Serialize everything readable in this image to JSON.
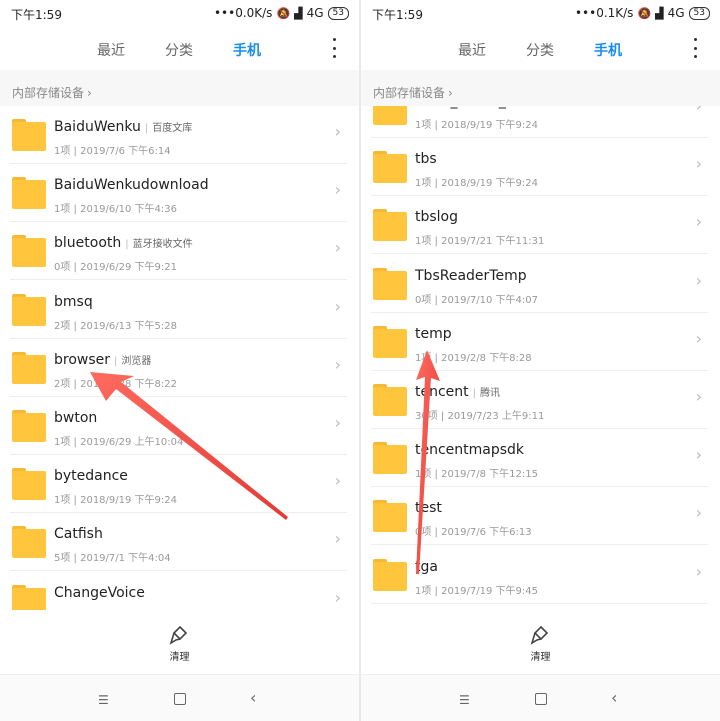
{
  "colors": {
    "accent": "#1a8cf0",
    "folder": "#ffc53d",
    "arrow": "#e84a4a"
  },
  "left": {
    "status": {
      "time": "下午1:59",
      "network": "•••0.0K/s",
      "signal": "4G",
      "battery": "53"
    },
    "tabs": [
      "最近",
      "分类",
      "手机"
    ],
    "active_tab": "手机",
    "breadcrumb": "内部存储设备",
    "items": [
      {
        "name": "BaiduWenku",
        "tag": "百度文库",
        "meta": "1项 | 2019/7/6 下午6:14"
      },
      {
        "name": "BaiduWenkudownload",
        "tag": "",
        "meta": "1项 | 2019/6/10 下午4:36"
      },
      {
        "name": "bluetooth",
        "tag": "蓝牙接收文件",
        "meta": "0项 | 2019/6/29 下午9:21"
      },
      {
        "name": "bmsq",
        "tag": "",
        "meta": "2项 | 2019/6/13 下午5:28"
      },
      {
        "name": "browser",
        "tag": "浏览器",
        "meta": "2项 | 2019/7/28 下午8:22"
      },
      {
        "name": "bwton",
        "tag": "",
        "meta": "1项 | 2019/6/29 上午10:04"
      },
      {
        "name": "bytedance",
        "tag": "",
        "meta": "1项 | 2018/9/19 下午9:24"
      },
      {
        "name": "Catfish",
        "tag": "",
        "meta": "5项 | 2019/7/1 下午4:04"
      },
      {
        "name": "ChangeVoice",
        "tag": "",
        "meta": ""
      }
    ],
    "cleaner_label": "清理"
  },
  "right": {
    "status": {
      "time": "下午1:59",
      "network": "•••0.1K/s",
      "signal": "4G",
      "battery": "53"
    },
    "tabs": [
      "最近",
      "分类",
      "手机"
    ],
    "active_tab": "手机",
    "breadcrumb": "内部存储设备",
    "items": [
      {
        "name": "taihe_music_sdk",
        "tag": "",
        "meta": "1项 | 2018/9/19 下午9:24"
      },
      {
        "name": "tbs",
        "tag": "",
        "meta": "1项 | 2018/9/19 下午9:24"
      },
      {
        "name": "tbslog",
        "tag": "",
        "meta": "1项 | 2019/7/21 下午11:31"
      },
      {
        "name": "TbsReaderTemp",
        "tag": "",
        "meta": "0项 | 2019/7/10 下午4:07"
      },
      {
        "name": "temp",
        "tag": "",
        "meta": "1项 | 2019/2/8 下午8:28"
      },
      {
        "name": "tencent",
        "tag": "腾讯",
        "meta": "30项 | 2019/7/23 上午9:11"
      },
      {
        "name": "tencentmapsdk",
        "tag": "",
        "meta": "1项 | 2019/7/8 下午12:15"
      },
      {
        "name": "test",
        "tag": "",
        "meta": "0项 | 2019/7/6 下午6:13"
      },
      {
        "name": "tga",
        "tag": "",
        "meta": "1项 | 2019/7/19 下午9:45"
      }
    ],
    "cleaner_label": "清理"
  }
}
